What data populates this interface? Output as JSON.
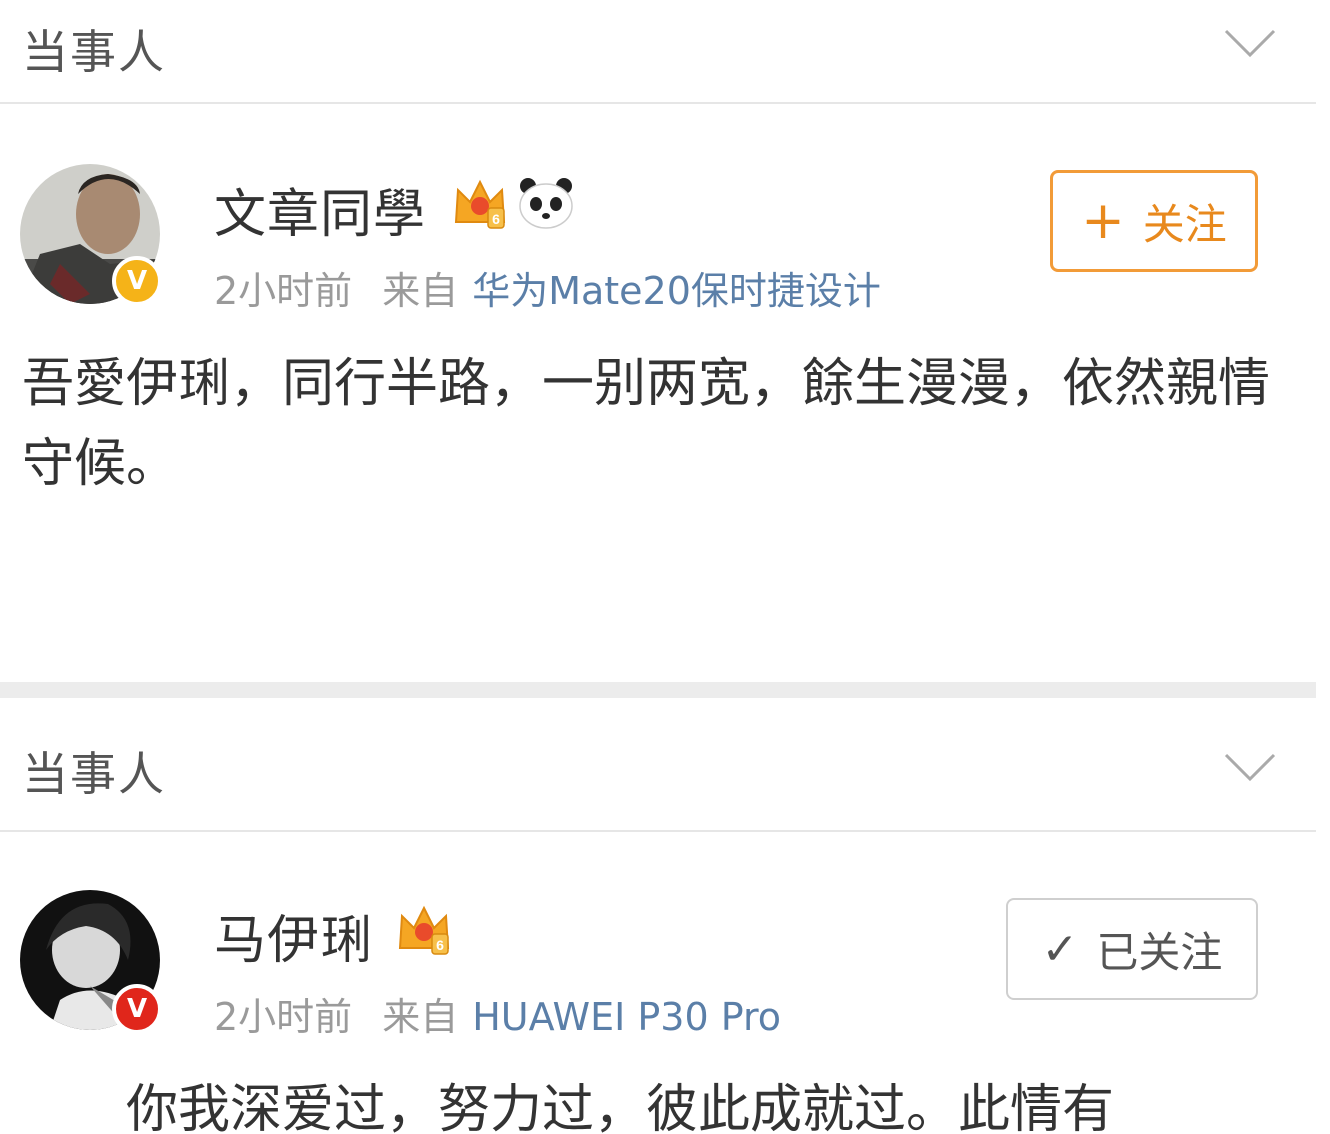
{
  "section_1": {
    "title": "当事人"
  },
  "post_1": {
    "username": "文章同學",
    "timestamp": "2小时前",
    "from_label": "来自",
    "device": "华为Mate20保时捷设计",
    "follow_icon": "+",
    "follow_label": "关注",
    "content": "吾愛伊琍，同行半路，一别两宽，餘生漫漫，依然親情守候。"
  },
  "section_2": {
    "title": "当事人"
  },
  "post_2": {
    "username": "马伊琍",
    "timestamp": "2小时前",
    "from_label": "来自",
    "device": "HUAWEI P30 Pro",
    "followed_icon": "✓",
    "followed_label": "已关注",
    "content": "你我深爱过，努力过，彼此成就过。此情有"
  },
  "badges": {
    "crown_level": "6"
  },
  "icons": [
    "chevron-down-icon",
    "crown-icon",
    "panda-icon",
    "verified-icon",
    "plus-icon",
    "check-icon"
  ],
  "colors": {
    "follow_orange": "#f29b38",
    "verified_yellow": "#f5b318",
    "verified_red": "#e0261b",
    "device_link": "#5b7fa8",
    "meta_gray": "#9a9a9a"
  }
}
